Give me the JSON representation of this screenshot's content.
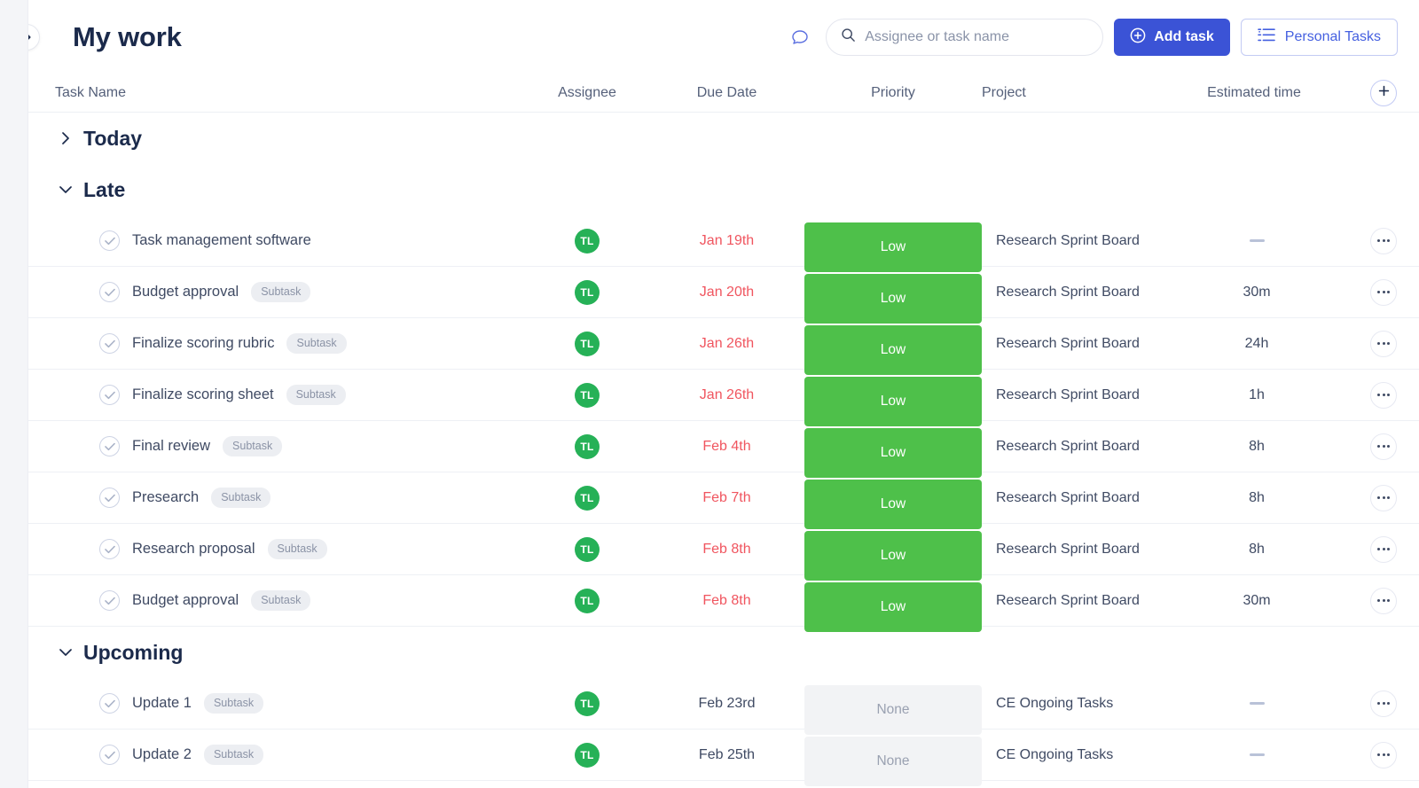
{
  "header": {
    "title": "My work",
    "collapse_icon": "chevron-right-icon",
    "chat_icon": "chat-bubble-icon",
    "search": {
      "icon": "search-icon",
      "placeholder": "Assignee or task name",
      "value": ""
    },
    "add_task": {
      "label": "Add task",
      "icon": "plus-circle-icon"
    },
    "personal_tasks": {
      "label": "Personal Tasks",
      "icon": "checklist-icon"
    }
  },
  "columns": {
    "task_name": "Task Name",
    "assignee": "Assignee",
    "due_date": "Due Date",
    "priority": "Priority",
    "project": "Project",
    "estimated_time": "Estimated time",
    "add_column_icon": "plus-icon"
  },
  "colors": {
    "accent": "#3b53d6",
    "priority_low": "#4ec04a",
    "priority_none_bg": "#f2f3f5",
    "avatar": "#26b157",
    "overdue_text": "#f0555f"
  },
  "groups": [
    {
      "name": "Today",
      "expanded": false,
      "chevron": "chevron-right-icon",
      "tasks": []
    },
    {
      "name": "Late",
      "expanded": true,
      "chevron": "chevron-down-icon",
      "tasks": [
        {
          "name": "Task management software",
          "badge": "",
          "assignee": "TL",
          "due": "Jan 19th",
          "overdue": true,
          "priority": "Low",
          "project": "Research Sprint Board",
          "estimate": ""
        },
        {
          "name": "Budget approval",
          "badge": "Subtask",
          "assignee": "TL",
          "due": "Jan 20th",
          "overdue": true,
          "priority": "Low",
          "project": "Research Sprint Board",
          "estimate": "30m"
        },
        {
          "name": "Finalize scoring rubric",
          "badge": "Subtask",
          "assignee": "TL",
          "due": "Jan 26th",
          "overdue": true,
          "priority": "Low",
          "project": "Research Sprint Board",
          "estimate": "24h"
        },
        {
          "name": "Finalize scoring sheet",
          "badge": "Subtask",
          "assignee": "TL",
          "due": "Jan 26th",
          "overdue": true,
          "priority": "Low",
          "project": "Research Sprint Board",
          "estimate": "1h"
        },
        {
          "name": "Final review",
          "badge": "Subtask",
          "assignee": "TL",
          "due": "Feb 4th",
          "overdue": true,
          "priority": "Low",
          "project": "Research Sprint Board",
          "estimate": "8h"
        },
        {
          "name": "Presearch",
          "badge": "Subtask",
          "assignee": "TL",
          "due": "Feb 7th",
          "overdue": true,
          "priority": "Low",
          "project": "Research Sprint Board",
          "estimate": "8h"
        },
        {
          "name": "Research proposal",
          "badge": "Subtask",
          "assignee": "TL",
          "due": "Feb 8th",
          "overdue": true,
          "priority": "Low",
          "project": "Research Sprint Board",
          "estimate": "8h"
        },
        {
          "name": "Budget approval",
          "badge": "Subtask",
          "assignee": "TL",
          "due": "Feb 8th",
          "overdue": true,
          "priority": "Low",
          "project": "Research Sprint Board",
          "estimate": "30m"
        }
      ]
    },
    {
      "name": "Upcoming",
      "expanded": true,
      "chevron": "chevron-down-icon",
      "tasks": [
        {
          "name": "Update 1",
          "badge": "Subtask",
          "assignee": "TL",
          "due": "Feb 23rd",
          "overdue": false,
          "priority": "None",
          "project": "CE Ongoing Tasks",
          "estimate": ""
        },
        {
          "name": "Update 2",
          "badge": "Subtask",
          "assignee": "TL",
          "due": "Feb 25th",
          "overdue": false,
          "priority": "None",
          "project": "CE Ongoing Tasks",
          "estimate": ""
        }
      ]
    }
  ]
}
